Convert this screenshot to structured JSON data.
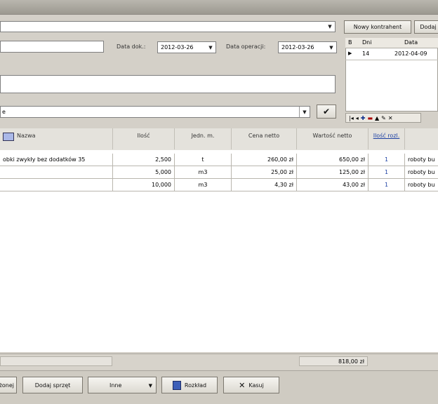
{
  "top": {
    "buttons": {
      "nowy_kontrahent": "Nowy kontrahent",
      "dodaj": "Dodaj"
    },
    "data_dok_label": "Data dok.:",
    "data_dok_value": "2012-03-26",
    "data_operacji_label": "Data operacji:",
    "data_operacji_value": "2012-03-26",
    "icons": {
      "combo": "chevron-down-icon",
      "confirm": "checkmark-icon"
    }
  },
  "dates_panel": {
    "headers": [
      "B",
      "Dni",
      "Data"
    ],
    "rows": [
      {
        "dni": "14",
        "data": "2012-04-09"
      }
    ],
    "nav_icons": [
      "first-icon",
      "prev-icon",
      "add-icon",
      "remove-icon",
      "up-icon",
      "edit-icon",
      "cancel-icon"
    ]
  },
  "main": {
    "combo_value": "e",
    "columns": [
      "Nazwa",
      "Ilość",
      "Jedn. m.",
      "Cena netto",
      "Wartość netto",
      "Ilość rozl.",
      ""
    ],
    "rows": [
      {
        "nazwa": "obki zwykły bez dodatków 35",
        "ilosc": "2,500",
        "jedn": "t",
        "cena": "260,00 zł",
        "wartosc": "650,00 zł",
        "rozl": "1",
        "opis": "roboty bu"
      },
      {
        "nazwa": "",
        "ilosc": "5,000",
        "jedn": "m3",
        "cena": "25,00 zł",
        "wartosc": "125,00 zł",
        "rozl": "1",
        "opis": "roboty bu"
      },
      {
        "nazwa": "",
        "ilosc": "10,000",
        "jedn": "m3",
        "cena": "4,30 zł",
        "wartosc": "43,00 zł",
        "rozl": "1",
        "opis": "roboty bu"
      }
    ],
    "total": "818,00 zł"
  },
  "bottom": {
    "buttons": {
      "b1": "żonej",
      "dodaj_sprzet": "Dodaj sprzęt",
      "inne": "Inne",
      "rozklad": "Rozkład",
      "kasuj": "Kasuj"
    }
  }
}
